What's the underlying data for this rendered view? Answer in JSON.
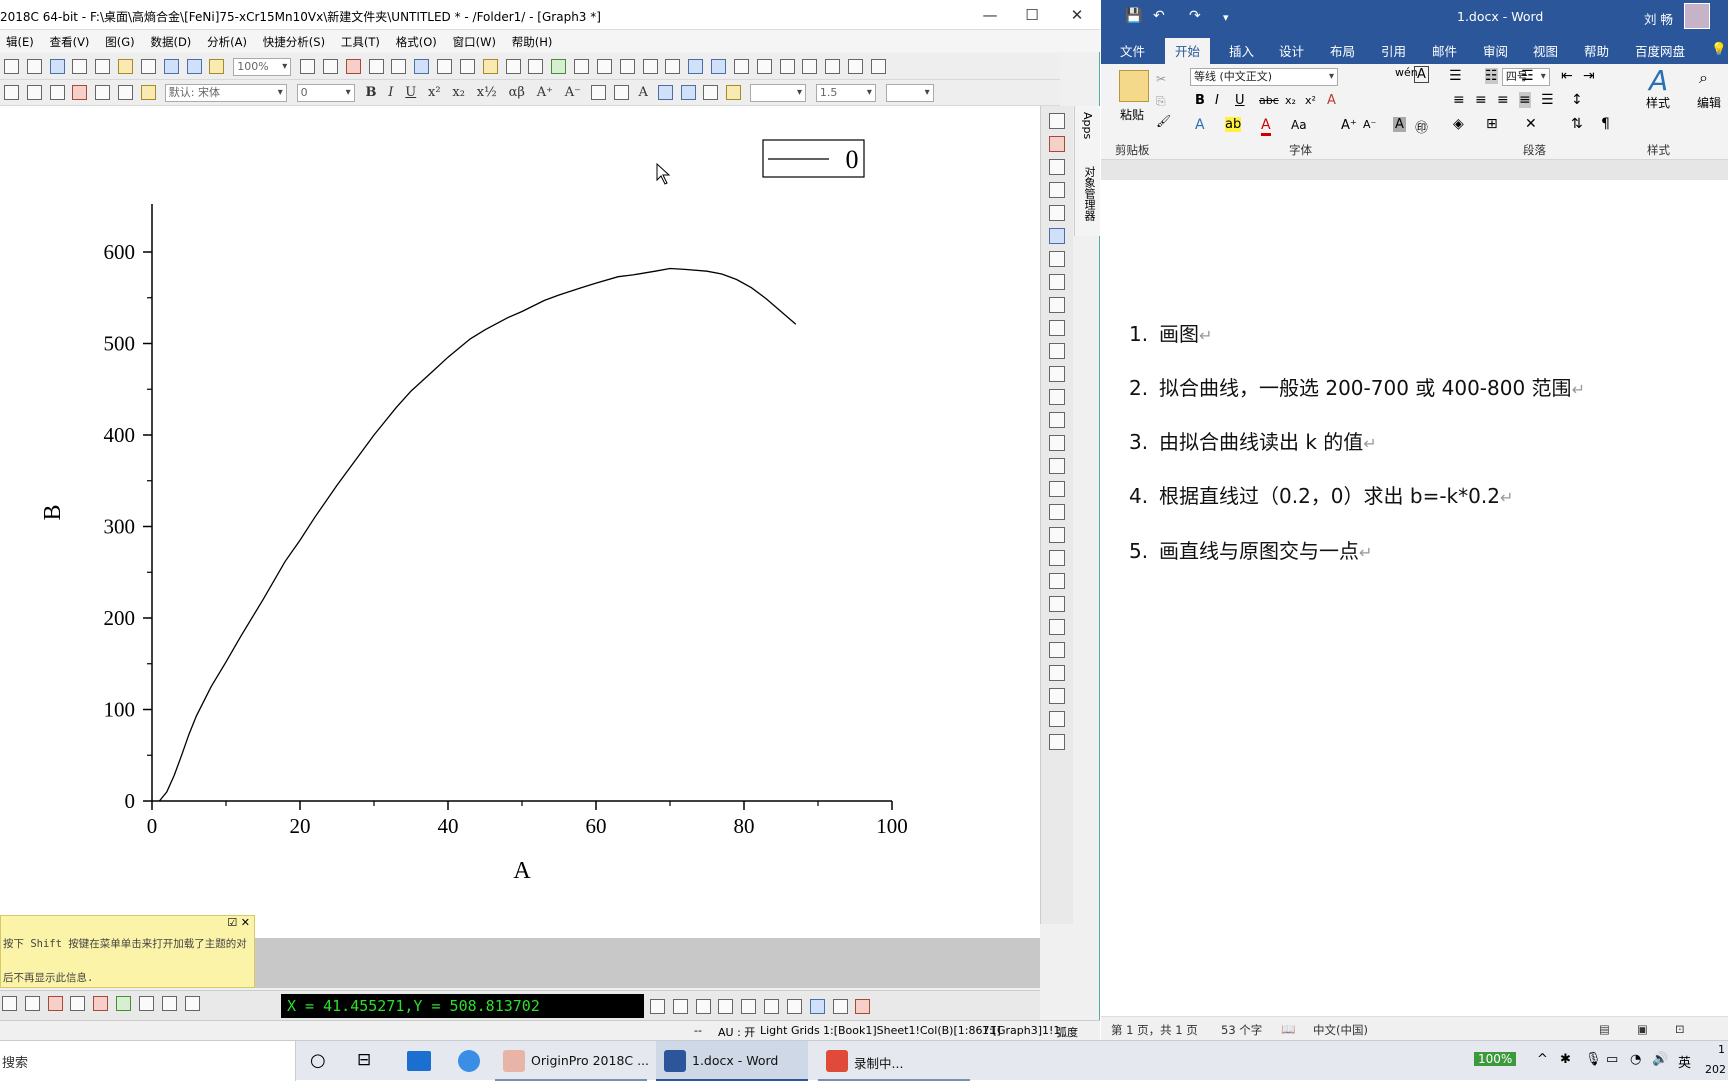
{
  "origin": {
    "title": "2018C 64-bit - F:\\桌面\\高熵合金\\[FeNi]75-xCr15Mn10Vx\\新建文件夹\\UNTITLED * - /Folder1/ - [Graph3 *]",
    "menu": [
      "辑(E)",
      "查看(V)",
      "图(G)",
      "数据(D)",
      "分析(A)",
      "快捷分析(S)",
      "工具(T)",
      "格式(O)",
      "窗口(W)",
      "帮助(H)"
    ],
    "zoom": "100%",
    "font_combo": "默认: 宋体",
    "size_combo": "0",
    "line_width": "1.5",
    "apps_label": "Apps",
    "object_manager_label": "对象管理器",
    "hint_line1": "按下 Shift 按键在菜单单击来打开加载了主题的对",
    "hint_line2": "后不再显示此信息.",
    "coord_readout": "X = 41.455271,Y = 508.813702",
    "status": {
      "dash": "--",
      "au": "AU : 开",
      "grids": "Light Grids",
      "col": "1:[Book1]Sheet1!Col(B)[1:8671]",
      "graph": "1:[Graph3]1!1",
      "unit": "弧度"
    }
  },
  "chart_data": {
    "type": "line",
    "xlabel": "A",
    "ylabel": "B",
    "xlim": [
      0,
      100
    ],
    "ylim": [
      0,
      650
    ],
    "xticks": [
      "0",
      "20",
      "40",
      "60",
      "80",
      "100"
    ],
    "yticks": [
      "0",
      "100",
      "200",
      "300",
      "400",
      "500",
      "600"
    ],
    "legend": {
      "entries": [
        "0"
      ],
      "placement": "top-right"
    },
    "series": [
      {
        "name": "0",
        "x": [
          1.0,
          2.0,
          3.0,
          4.0,
          5.0,
          6.0,
          8.0,
          10.0,
          12.0,
          15.0,
          18.0,
          20.0,
          22.0,
          25.0,
          28.0,
          30.0,
          33.0,
          35.0,
          38.0,
          40.0,
          43.0,
          45.0,
          48.0,
          50.0,
          53.0,
          55.0,
          58.0,
          60.0,
          63.0,
          65.0,
          68.0,
          70.0,
          72.0,
          75.0,
          77.0,
          79.0,
          81.0,
          83.0,
          85.0,
          87.0
        ],
        "y": [
          0,
          10,
          28,
          50,
          73,
          93,
          125,
          152,
          180,
          220,
          262,
          285,
          310,
          345,
          378,
          400,
          430,
          448,
          470,
          485,
          505,
          515,
          528,
          535,
          547,
          553,
          561,
          566,
          573,
          575,
          579,
          582,
          581,
          579,
          576,
          570,
          561,
          549,
          535,
          521
        ]
      }
    ]
  },
  "word": {
    "title": "1.docx - Word",
    "user": "刘 畅",
    "tabs": [
      "文件",
      "开始",
      "插入",
      "设计",
      "布局",
      "引用",
      "邮件",
      "审阅",
      "视图",
      "帮助",
      "百度网盘"
    ],
    "font": "等线 (中文正文)",
    "font_size": "四号",
    "paste_label": "粘贴",
    "styles_label": "样式",
    "edit_label": "编辑",
    "group_labels": [
      "剪贴板",
      "字体",
      "段落",
      "样式"
    ],
    "list": [
      {
        "num": "1.",
        "text": "画图"
      },
      {
        "num": "2.",
        "text": "拟合曲线，一般选 200-700 或 400-800 范围"
      },
      {
        "num": "3.",
        "text": "由拟合曲线读出 k 的值"
      },
      {
        "num": "4.",
        "text": "根据直线过（0.2，0）求出 b=-k*0.2"
      },
      {
        "num": "5.",
        "text": "画直线与原图交与一点"
      }
    ],
    "para_mark": "↵",
    "status": {
      "page": "第 1 页，共 1 页",
      "words": "53 个字",
      "lang": "中文(中国)"
    }
  },
  "taskbar": {
    "search": "搜索",
    "items": [
      "OriginPro 2018C ...",
      "1.docx - Word",
      "录制中..."
    ],
    "battery": "100%",
    "ime": "英",
    "clock_top": "1",
    "clock_bottom": "202"
  }
}
